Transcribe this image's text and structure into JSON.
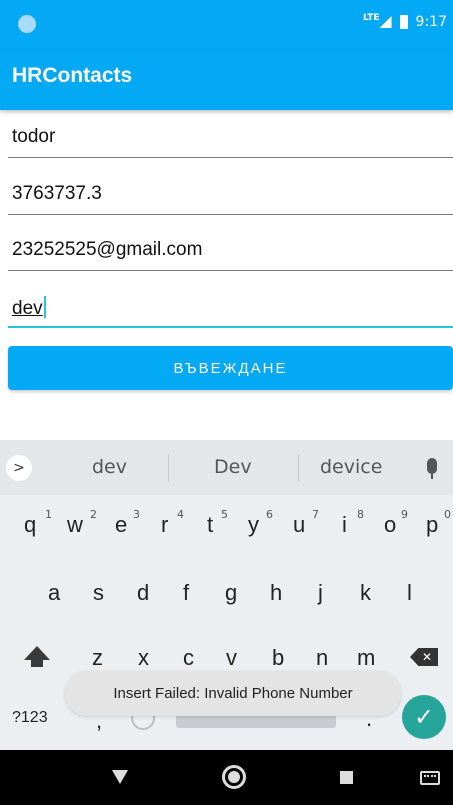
{
  "status_bar": {
    "network": "LTE",
    "time": "9:17"
  },
  "app_bar": {
    "title": "HRContacts"
  },
  "form": {
    "name_value": "todor",
    "phone_value": "3763737.3",
    "email_value": "23252525@gmail.com",
    "position_value": "dev",
    "submit_label": "ВЪВЕЖДАНЕ"
  },
  "keyboard": {
    "expand_glyph": ">",
    "suggestions": [
      "dev",
      "Dev",
      "device"
    ],
    "row1": [
      "q",
      "w",
      "e",
      "r",
      "t",
      "y",
      "u",
      "i",
      "o",
      "p"
    ],
    "row1_numbers": [
      "1",
      "2",
      "3",
      "4",
      "5",
      "6",
      "7",
      "8",
      "9",
      "0"
    ],
    "row2": [
      "a",
      "s",
      "d",
      "f",
      "g",
      "h",
      "j",
      "k",
      "l"
    ],
    "row3": [
      "z",
      "x",
      "c",
      "v",
      "b",
      "n",
      "m"
    ],
    "symbols_label": "?123",
    "comma": ",",
    "period": ".",
    "enter_glyph": "✓",
    "backspace_glyph": "✕"
  },
  "toast": {
    "message": "Insert Failed: Invalid Phone Number"
  },
  "colors": {
    "primary": "#03A9F4",
    "accent": "#26C6DA",
    "enter": "#26A69A"
  }
}
